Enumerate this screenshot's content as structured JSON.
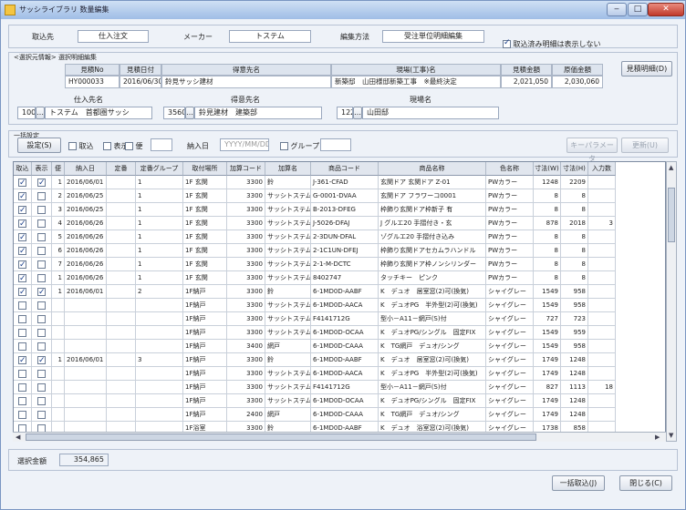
{
  "window": {
    "title": "サッシライブラリ 数量編集",
    "minimize": "‒",
    "maximize": "□",
    "close": "✕"
  },
  "top": {
    "kind_label": "取込先",
    "kind_value": "仕入注文",
    "maker_label": "メーカー",
    "maker_value": "トステム",
    "edit_label": "編集方法",
    "edit_value": "受注単位明細編集",
    "option_label": "取込済み明細は表示しない"
  },
  "estimate": {
    "section": "<選択元情報> 選択明細編集",
    "headers": [
      "見積No",
      "見積日付",
      "得意先名",
      "現場(工事)名",
      "見積金額",
      "原価金額"
    ],
    "values": [
      "HY000033",
      "2016/06/30",
      "鈴見サッシ建材",
      "新築邸　山田様邸新築工事　※最終決定",
      "2,021,050",
      "2,030,060"
    ],
    "detail_button": "見積明細(D)"
  },
  "supplier": {
    "order_to_label": "仕入先名",
    "order_to_code": "100",
    "order_to_name": "トステム　首都圏サッシ",
    "customer_label": "得意先名",
    "customer_code": "3560",
    "customer_name": "鈴見建材　建築部",
    "site_label": "現場名",
    "site_code": "122",
    "site_name": "山田邸"
  },
  "bulk": {
    "section": "一括設定",
    "set_button": "設定(S)",
    "take_label": "取込",
    "display_label": "表示",
    "flight_label": "便",
    "date_label": "納入日",
    "date_placeholder": "YYYY/MM/DD",
    "group_label": "グループ",
    "btn_right1": "キーパラメータ",
    "btn_right2": "更新(U)"
  },
  "grid": {
    "columns": [
      "取込",
      "表示",
      "便",
      "納入日",
      "定番",
      "定番グループ",
      "取付場所",
      "加算コード",
      "加算名",
      "商品コード",
      "商品名称",
      "色名称",
      "寸法(W)",
      "寸法(H)",
      "入力数"
    ],
    "rows": [
      {
        "take": true,
        "show": true,
        "flight": "1",
        "date": "2016/06/01",
        "std": "",
        "grp": "1",
        "place": "1F 玄関",
        "code": "3300",
        "name": "鈴",
        "pcode": "J-361-CFAD",
        "pname": "玄関ドア 玄関ドア Z-01",
        "color": "PWカラー",
        "w": "1248",
        "h": "2209",
        "qty": ""
      },
      {
        "take": true,
        "show": false,
        "flight": "2",
        "date": "2016/06/25",
        "std": "",
        "grp": "1",
        "place": "1F 玄関",
        "code": "3300",
        "name": "サッシトステム",
        "pcode": "G-0001-DVAA",
        "pname": "玄関ドア フラワーコ0001",
        "color": "PWカラー",
        "w": "8",
        "h": "8",
        "qty": ""
      },
      {
        "take": true,
        "show": false,
        "flight": "3",
        "date": "2016/06/25",
        "std": "",
        "grp": "1",
        "place": "1F 玄関",
        "code": "3300",
        "name": "サッシトステム",
        "pcode": "B-2013-DFEG",
        "pname": "枠飾り玄関ドア枠新子 有",
        "color": "PWカラー",
        "w": "8",
        "h": "8",
        "qty": ""
      },
      {
        "take": true,
        "show": false,
        "flight": "4",
        "date": "2016/06/26",
        "std": "",
        "grp": "1",
        "place": "1F 玄関",
        "code": "3300",
        "name": "サッシトステム",
        "pcode": "J-5026-DFAJ",
        "pname": "J グルエ20 手摺付き・玄",
        "color": "PWカラー",
        "w": "878",
        "h": "2018",
        "qty": "3"
      },
      {
        "take": true,
        "show": false,
        "flight": "5",
        "date": "2016/06/26",
        "std": "",
        "grp": "1",
        "place": "1F 玄関",
        "code": "3300",
        "name": "サッシトステム",
        "pcode": "2-3DUN-DFAL",
        "pname": "ゾグルエ20 手摺付き込み",
        "color": "PWカラー",
        "w": "8",
        "h": "8",
        "qty": ""
      },
      {
        "take": true,
        "show": false,
        "flight": "6",
        "date": "2016/06/26",
        "std": "",
        "grp": "1",
        "place": "1F 玄関",
        "code": "3300",
        "name": "サッシトステム",
        "pcode": "2-1C1UN-DFEJ",
        "pname": "枠飾り玄関ドアセカムラハンドル",
        "color": "PWカラー",
        "w": "8",
        "h": "8",
        "qty": ""
      },
      {
        "take": true,
        "show": false,
        "flight": "7",
        "date": "2016/06/26",
        "std": "",
        "grp": "1",
        "place": "1F 玄関",
        "code": "3300",
        "name": "サッシトステム",
        "pcode": "2-1-M-DCTC",
        "pname": "枠飾り玄関ドア枠ノンシリンダー",
        "color": "PWカラー",
        "w": "8",
        "h": "8",
        "qty": ""
      },
      {
        "take": true,
        "show": false,
        "flight": "1",
        "date": "2016/06/26",
        "std": "",
        "grp": "1",
        "place": "1F 玄関",
        "code": "3300",
        "name": "サッシトステム",
        "pcode": "8402747",
        "pname": "タッチキー　ピンク",
        "color": "PWカラー",
        "w": "8",
        "h": "8",
        "qty": ""
      },
      {
        "take": true,
        "show": true,
        "flight": "1",
        "date": "2016/06/01",
        "std": "",
        "grp": "2",
        "place": "1F納戸",
        "code": "3300",
        "name": "鈴",
        "pcode": "6-1MD0D-AABF",
        "pname": "K　デュオ　居室窓(2)可(換気)",
        "color": "シャイグレー",
        "w": "1549",
        "h": "958",
        "qty": ""
      },
      {
        "take": false,
        "show": false,
        "flight": "",
        "date": "",
        "std": "",
        "grp": "",
        "place": "1F納戸",
        "code": "3300",
        "name": "サッシトステム",
        "pcode": "6-1MD0D-AACA",
        "pname": "K　デュオPG　半外型(2)可(換気)",
        "color": "シャイグレー",
        "w": "1549",
        "h": "958",
        "qty": ""
      },
      {
        "take": false,
        "show": false,
        "flight": "",
        "date": "",
        "std": "",
        "grp": "",
        "place": "1F納戸",
        "code": "3300",
        "name": "サッシトステム",
        "pcode": "F4141712G",
        "pname": "型小－A11－網戸(S)付",
        "color": "シャイグレー",
        "w": "727",
        "h": "723",
        "qty": ""
      },
      {
        "take": false,
        "show": false,
        "flight": "",
        "date": "",
        "std": "",
        "grp": "",
        "place": "1F納戸",
        "code": "3300",
        "name": "サッシトステム",
        "pcode": "6-1MD0D-OCAA",
        "pname": "K　デュオPG/シングル　固定FIX",
        "color": "シャイグレー",
        "w": "1549",
        "h": "959",
        "qty": ""
      },
      {
        "take": false,
        "show": false,
        "flight": "",
        "date": "",
        "std": "",
        "grp": "",
        "place": "1F納戸",
        "code": "3400",
        "name": "網戸",
        "pcode": "6-1MD0D-CAAA",
        "pname": "K　TG網戸　デュオ/シング",
        "color": "シャイグレー",
        "w": "1549",
        "h": "958",
        "qty": ""
      },
      {
        "take": true,
        "show": true,
        "flight": "1",
        "date": "2016/06/01",
        "std": "",
        "grp": "3",
        "place": "1F納戸",
        "code": "3300",
        "name": "鈴",
        "pcode": "6-1MD0D-AABF",
        "pname": "K　デュオ　居室窓(2)可(換気)",
        "color": "シャイグレー",
        "w": "1749",
        "h": "1248",
        "qty": ""
      },
      {
        "take": false,
        "show": false,
        "flight": "",
        "date": "",
        "std": "",
        "grp": "",
        "place": "1F納戸",
        "code": "3300",
        "name": "サッシトステム",
        "pcode": "6-1MD0D-AACA",
        "pname": "K　デュオPG　半外型(2)可(換気)",
        "color": "シャイグレー",
        "w": "1749",
        "h": "1248",
        "qty": ""
      },
      {
        "take": false,
        "show": false,
        "flight": "",
        "date": "",
        "std": "",
        "grp": "",
        "place": "1F納戸",
        "code": "3300",
        "name": "サッシトステム",
        "pcode": "F4141712G",
        "pname": "型小－A11－網戸(S)付",
        "color": "シャイグレー",
        "w": "827",
        "h": "1113",
        "qty": "18"
      },
      {
        "take": false,
        "show": false,
        "flight": "",
        "date": "",
        "std": "",
        "grp": "",
        "place": "1F納戸",
        "code": "3300",
        "name": "サッシトステム",
        "pcode": "6-1MD0D-OCAA",
        "pname": "K　デュオPG/シングル　固定FIX",
        "color": "シャイグレー",
        "w": "1749",
        "h": "1248",
        "qty": ""
      },
      {
        "take": false,
        "show": false,
        "flight": "",
        "date": "",
        "std": "",
        "grp": "",
        "place": "1F納戸",
        "code": "2400",
        "name": "網戸",
        "pcode": "6-1MD0D-CAAA",
        "pname": "K　TG網戸　デュオ/シング",
        "color": "シャイグレー",
        "w": "1749",
        "h": "1248",
        "qty": ""
      },
      {
        "take": false,
        "show": false,
        "flight": "",
        "date": "",
        "std": "",
        "grp": "",
        "place": "1F浴室",
        "code": "3300",
        "name": "鈴",
        "pcode": "6-1MD0D-AABF",
        "pname": "K　デュオ　浴室窓(2)可(換気)",
        "color": "シャイグレー",
        "w": "1738",
        "h": "858",
        "qty": ""
      }
    ]
  },
  "footer": {
    "total_label": "選択金額",
    "total_value": "354,865",
    "btn_bulk": "一括取込(J)",
    "btn_close": "閉じる(C)"
  },
  "colors": {
    "accent": "#7a96c2",
    "titlebar": "#9fbde6"
  }
}
